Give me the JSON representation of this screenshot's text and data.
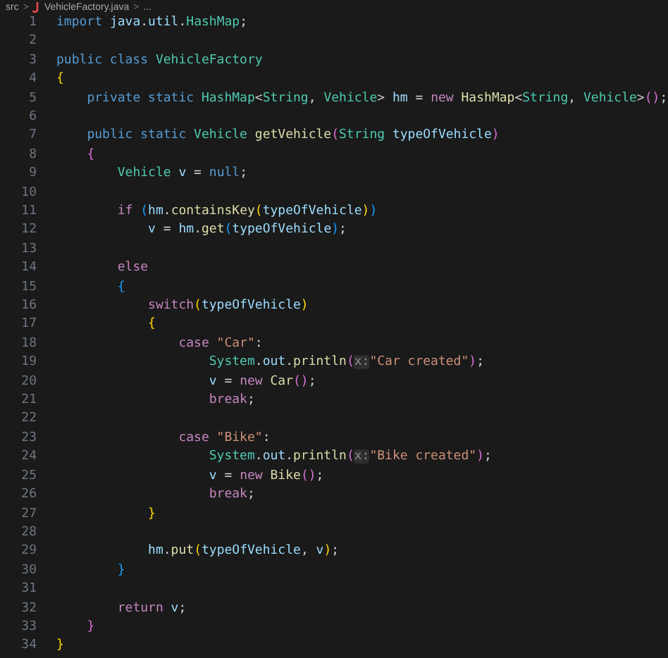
{
  "breadcrumb": {
    "folder": "src",
    "separator_1": ">",
    "file": "VehicleFactory.java",
    "separator_2": ">",
    "more": "..."
  },
  "lines": [
    {
      "number": "1",
      "tokens": [
        {
          "kind": "keyword",
          "text": "import "
        },
        {
          "kind": "variable",
          "text": "java"
        },
        {
          "kind": "plain",
          "text": "."
        },
        {
          "kind": "variable",
          "text": "util"
        },
        {
          "kind": "plain",
          "text": "."
        },
        {
          "kind": "type",
          "text": "HashMap"
        },
        {
          "kind": "plain",
          "text": ";"
        }
      ]
    },
    {
      "number": "2"
    },
    {
      "number": "3",
      "tokens": [
        {
          "kind": "keyword",
          "text": "public class "
        },
        {
          "kind": "type",
          "text": "VehicleFactory"
        }
      ]
    },
    {
      "number": "4",
      "tokens": [
        {
          "kind": "bracket1",
          "text": "{"
        }
      ]
    },
    {
      "number": "5",
      "tokens": [
        {
          "kind": "keyword",
          "text": "    private static "
        },
        {
          "kind": "type",
          "text": "HashMap"
        },
        {
          "kind": "plain",
          "text": "<"
        },
        {
          "kind": "type",
          "text": "String"
        },
        {
          "kind": "plain",
          "text": ", "
        },
        {
          "kind": "type",
          "text": "Vehicle"
        },
        {
          "kind": "plain",
          "text": "> "
        },
        {
          "kind": "variable",
          "text": "hm"
        },
        {
          "kind": "plain",
          "text": " = "
        },
        {
          "kind": "control",
          "text": "new "
        },
        {
          "kind": "function",
          "text": "HashMap"
        },
        {
          "kind": "plain",
          "text": "<"
        },
        {
          "kind": "type",
          "text": "String"
        },
        {
          "kind": "plain",
          "text": ", "
        },
        {
          "kind": "type",
          "text": "Vehicle"
        },
        {
          "kind": "plain",
          "text": ">"
        },
        {
          "kind": "bracket2",
          "text": "()"
        },
        {
          "kind": "plain",
          "text": ";"
        }
      ]
    },
    {
      "number": "6"
    },
    {
      "number": "7",
      "tokens": [
        {
          "kind": "keyword",
          "text": "    public static "
        },
        {
          "kind": "type",
          "text": "Vehicle "
        },
        {
          "kind": "function",
          "text": "getVehicle"
        },
        {
          "kind": "bracket2",
          "text": "("
        },
        {
          "kind": "type",
          "text": "String "
        },
        {
          "kind": "variable",
          "text": "typeOfVehicle"
        },
        {
          "kind": "bracket2",
          "text": ")"
        }
      ]
    },
    {
      "number": "8",
      "tokens": [
        {
          "kind": "bracket2",
          "text": "    {"
        }
      ]
    },
    {
      "number": "9",
      "tokens": [
        {
          "kind": "type",
          "text": "        Vehicle "
        },
        {
          "kind": "variable",
          "text": "v"
        },
        {
          "kind": "plain",
          "text": " = "
        },
        {
          "kind": "keyword",
          "text": "null"
        },
        {
          "kind": "plain",
          "text": ";"
        }
      ]
    },
    {
      "number": "10"
    },
    {
      "number": "11",
      "tokens": [
        {
          "kind": "control",
          "text": "        if "
        },
        {
          "kind": "bracket3",
          "text": "("
        },
        {
          "kind": "variable",
          "text": "hm"
        },
        {
          "kind": "plain",
          "text": "."
        },
        {
          "kind": "function",
          "text": "containsKey"
        },
        {
          "kind": "bracket1",
          "text": "("
        },
        {
          "kind": "variable",
          "text": "typeOfVehicle"
        },
        {
          "kind": "bracket1",
          "text": ")"
        },
        {
          "kind": "bracket3",
          "text": ")"
        }
      ]
    },
    {
      "number": "12",
      "tokens": [
        {
          "kind": "variable",
          "text": "            v"
        },
        {
          "kind": "plain",
          "text": " = "
        },
        {
          "kind": "variable",
          "text": "hm"
        },
        {
          "kind": "plain",
          "text": "."
        },
        {
          "kind": "function",
          "text": "get"
        },
        {
          "kind": "bracket3",
          "text": "("
        },
        {
          "kind": "variable",
          "text": "typeOfVehicle"
        },
        {
          "kind": "bracket3",
          "text": ")"
        },
        {
          "kind": "plain",
          "text": ";"
        }
      ]
    },
    {
      "number": "13"
    },
    {
      "number": "14",
      "tokens": [
        {
          "kind": "control",
          "text": "        else"
        }
      ]
    },
    {
      "number": "15",
      "tokens": [
        {
          "kind": "bracket3",
          "text": "        {"
        }
      ]
    },
    {
      "number": "16",
      "tokens": [
        {
          "kind": "control",
          "text": "            switch"
        },
        {
          "kind": "bracket1",
          "text": "("
        },
        {
          "kind": "variable",
          "text": "typeOfVehicle"
        },
        {
          "kind": "bracket1",
          "text": ")"
        }
      ]
    },
    {
      "number": "17",
      "tokens": [
        {
          "kind": "bracket1",
          "text": "            {"
        }
      ]
    },
    {
      "number": "18",
      "tokens": [
        {
          "kind": "control",
          "text": "                case "
        },
        {
          "kind": "string",
          "text": "\"Car\""
        },
        {
          "kind": "plain",
          "text": ":"
        }
      ]
    },
    {
      "number": "19",
      "tokens": [
        {
          "kind": "type",
          "text": "                    System"
        },
        {
          "kind": "plain",
          "text": "."
        },
        {
          "kind": "variable",
          "text": "out"
        },
        {
          "kind": "plain",
          "text": "."
        },
        {
          "kind": "function",
          "text": "println"
        },
        {
          "kind": "bracket2",
          "text": "("
        },
        {
          "kind": "hint",
          "text": "x:"
        },
        {
          "kind": "string",
          "text": "\"Car created\""
        },
        {
          "kind": "bracket2",
          "text": ")"
        },
        {
          "kind": "plain",
          "text": ";"
        }
      ]
    },
    {
      "number": "20",
      "tokens": [
        {
          "kind": "variable",
          "text": "                    v"
        },
        {
          "kind": "plain",
          "text": " = "
        },
        {
          "kind": "control",
          "text": "new "
        },
        {
          "kind": "function",
          "text": "Car"
        },
        {
          "kind": "bracket2",
          "text": "()"
        },
        {
          "kind": "plain",
          "text": ";"
        }
      ]
    },
    {
      "number": "21",
      "tokens": [
        {
          "kind": "control",
          "text": "                    break"
        },
        {
          "kind": "plain",
          "text": ";"
        }
      ]
    },
    {
      "number": "22"
    },
    {
      "number": "23",
      "tokens": [
        {
          "kind": "control",
          "text": "                case "
        },
        {
          "kind": "string",
          "text": "\"Bike\""
        },
        {
          "kind": "plain",
          "text": ":"
        }
      ]
    },
    {
      "number": "24",
      "tokens": [
        {
          "kind": "type",
          "text": "                    System"
        },
        {
          "kind": "plain",
          "text": "."
        },
        {
          "kind": "variable",
          "text": "out"
        },
        {
          "kind": "plain",
          "text": "."
        },
        {
          "kind": "function",
          "text": "println"
        },
        {
          "kind": "bracket2",
          "text": "("
        },
        {
          "kind": "hint",
          "text": "x:"
        },
        {
          "kind": "string",
          "text": "\"Bike created\""
        },
        {
          "kind": "bracket2",
          "text": ")"
        },
        {
          "kind": "plain",
          "text": ";"
        }
      ]
    },
    {
      "number": "25",
      "tokens": [
        {
          "kind": "variable",
          "text": "                    v"
        },
        {
          "kind": "plain",
          "text": " = "
        },
        {
          "kind": "control",
          "text": "new "
        },
        {
          "kind": "function",
          "text": "Bike"
        },
        {
          "kind": "bracket2",
          "text": "()"
        },
        {
          "kind": "plain",
          "text": ";"
        }
      ]
    },
    {
      "number": "26",
      "tokens": [
        {
          "kind": "control",
          "text": "                    break"
        },
        {
          "kind": "plain",
          "text": ";"
        }
      ]
    },
    {
      "number": "27",
      "tokens": [
        {
          "kind": "bracket1",
          "text": "            }"
        }
      ]
    },
    {
      "number": "28"
    },
    {
      "number": "29",
      "tokens": [
        {
          "kind": "variable",
          "text": "            hm"
        },
        {
          "kind": "plain",
          "text": "."
        },
        {
          "kind": "function",
          "text": "put"
        },
        {
          "kind": "bracket1",
          "text": "("
        },
        {
          "kind": "variable",
          "text": "typeOfVehicle"
        },
        {
          "kind": "plain",
          "text": ", "
        },
        {
          "kind": "variable",
          "text": "v"
        },
        {
          "kind": "bracket1",
          "text": ")"
        },
        {
          "kind": "plain",
          "text": ";"
        }
      ]
    },
    {
      "number": "30",
      "tokens": [
        {
          "kind": "bracket3",
          "text": "        }"
        }
      ]
    },
    {
      "number": "31"
    },
    {
      "number": "32",
      "tokens": [
        {
          "kind": "control",
          "text": "        return "
        },
        {
          "kind": "variable",
          "text": "v"
        },
        {
          "kind": "plain",
          "text": ";"
        }
      ]
    },
    {
      "number": "33",
      "tokens": [
        {
          "kind": "bracket2",
          "text": "    }"
        }
      ]
    },
    {
      "number": "34",
      "tokens": [
        {
          "kind": "bracket1",
          "text": "}"
        }
      ]
    }
  ]
}
